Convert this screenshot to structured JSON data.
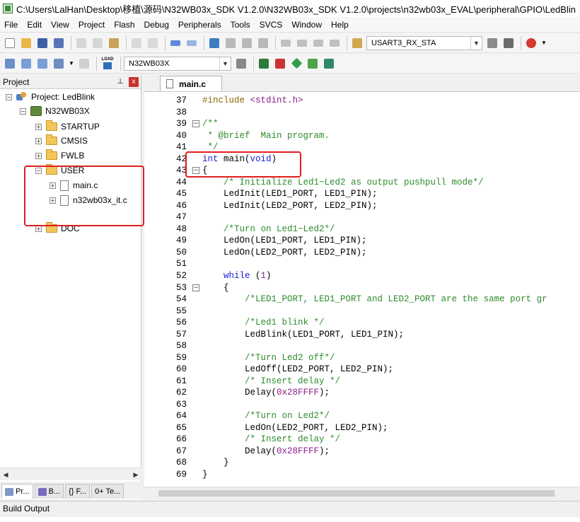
{
  "window": {
    "title": "C:\\Users\\LalHan\\Desktop\\移植\\源码\\N32WB03x_SDK V1.2.0\\N32WB03x_SDK V1.2.0\\projects\\n32wb03x_EVAL\\peripheral\\GPIO\\LedBlin"
  },
  "menu": [
    {
      "label": "File"
    },
    {
      "label": "Edit"
    },
    {
      "label": "View"
    },
    {
      "label": "Project"
    },
    {
      "label": "Flash"
    },
    {
      "label": "Debug"
    },
    {
      "label": "Peripherals"
    },
    {
      "label": "Tools"
    },
    {
      "label": "SVCS"
    },
    {
      "label": "Window"
    },
    {
      "label": "Help"
    }
  ],
  "toolbar1": {
    "find_combo_value": "USART3_RX_STA"
  },
  "toolbar2": {
    "load_label": "LOAD",
    "target_combo_value": "N32WB03X"
  },
  "project_pane": {
    "title": "Project",
    "pin_glyph": "⊥",
    "close_glyph": "x",
    "tree": [
      {
        "label": "Project: LedBlink"
      },
      {
        "label": "N32WB03X"
      },
      {
        "label": "STARTUP"
      },
      {
        "label": "CMSIS"
      },
      {
        "label": "FWLB"
      },
      {
        "label": "USER"
      },
      {
        "label": "main.c"
      },
      {
        "label": "n32wb03x_it.c"
      },
      {
        "label": "DOC"
      }
    ],
    "tabs": [
      {
        "label": "Pr..."
      },
      {
        "label": "B..."
      },
      {
        "label": "{} F..."
      },
      {
        "label": "0+ Te..."
      }
    ]
  },
  "editor": {
    "tab_label": "main.c",
    "lines": [
      {
        "n": "37",
        "fold": "",
        "seg": [
          {
            "c": "c-pre",
            "t": "#include "
          },
          {
            "c": "c-str",
            "t": "<stdint.h>"
          }
        ]
      },
      {
        "n": "38",
        "fold": "",
        "seg": []
      },
      {
        "n": "39",
        "fold": "−",
        "seg": [
          {
            "c": "c-com",
            "t": "/**"
          }
        ]
      },
      {
        "n": "40",
        "fold": "",
        "seg": [
          {
            "c": "c-com",
            "t": " * @brief  Main program."
          }
        ]
      },
      {
        "n": "41",
        "fold": "",
        "seg": [
          {
            "c": "c-com",
            "t": " */"
          }
        ]
      },
      {
        "n": "42",
        "fold": "",
        "seg": [
          {
            "c": "c-key",
            "t": "int"
          },
          {
            "c": "txt",
            "t": " main("
          },
          {
            "c": "c-key",
            "t": "void"
          },
          {
            "c": "txt",
            "t": ")"
          }
        ]
      },
      {
        "n": "43",
        "fold": "−",
        "seg": [
          {
            "c": "txt",
            "t": "{"
          }
        ]
      },
      {
        "n": "44",
        "fold": "",
        "seg": [
          {
            "c": "c-com",
            "t": "    /* Initialize Led1~Led2 as output pushpull mode*/"
          }
        ]
      },
      {
        "n": "45",
        "fold": "",
        "seg": [
          {
            "c": "txt",
            "t": "    LedInit(LED1_PORT, LED1_PIN);"
          }
        ]
      },
      {
        "n": "46",
        "fold": "",
        "seg": [
          {
            "c": "txt",
            "t": "    LedInit(LED2_PORT, LED2_PIN);"
          }
        ]
      },
      {
        "n": "47",
        "fold": "",
        "seg": []
      },
      {
        "n": "48",
        "fold": "",
        "seg": [
          {
            "c": "c-com",
            "t": "    /*Turn on Led1~Led2*/"
          }
        ]
      },
      {
        "n": "49",
        "fold": "",
        "seg": [
          {
            "c": "txt",
            "t": "    LedOn(LED1_PORT, LED1_PIN);"
          }
        ]
      },
      {
        "n": "50",
        "fold": "",
        "seg": [
          {
            "c": "txt",
            "t": "    LedOn(LED2_PORT, LED2_PIN);"
          }
        ]
      },
      {
        "n": "51",
        "fold": "",
        "seg": []
      },
      {
        "n": "52",
        "fold": "",
        "seg": [
          {
            "c": "c-key",
            "t": "    while"
          },
          {
            "c": "txt",
            "t": " ("
          },
          {
            "c": "c-num",
            "t": "1"
          },
          {
            "c": "txt",
            "t": ")"
          }
        ]
      },
      {
        "n": "53",
        "fold": "−",
        "seg": [
          {
            "c": "txt",
            "t": "    {"
          }
        ]
      },
      {
        "n": "54",
        "fold": "",
        "seg": [
          {
            "c": "c-com",
            "t": "        /*LED1_PORT, LED1_PORT and LED2_PORT are the same port gr"
          }
        ]
      },
      {
        "n": "55",
        "fold": "",
        "seg": []
      },
      {
        "n": "56",
        "fold": "",
        "seg": [
          {
            "c": "c-com",
            "t": "        /*Led1 blink */"
          }
        ]
      },
      {
        "n": "57",
        "fold": "",
        "seg": [
          {
            "c": "txt",
            "t": "        LedBlink(LED1_PORT, LED1_PIN);"
          }
        ]
      },
      {
        "n": "58",
        "fold": "",
        "seg": []
      },
      {
        "n": "59",
        "fold": "",
        "seg": [
          {
            "c": "c-com",
            "t": "        /*Turn Led2 off*/"
          }
        ]
      },
      {
        "n": "60",
        "fold": "",
        "seg": [
          {
            "c": "txt",
            "t": "        LedOff(LED2_PORT, LED2_PIN);"
          }
        ]
      },
      {
        "n": "61",
        "fold": "",
        "seg": [
          {
            "c": "c-com",
            "t": "        /* Insert delay */"
          }
        ]
      },
      {
        "n": "62",
        "fold": "",
        "seg": [
          {
            "c": "txt",
            "t": "        Delay("
          },
          {
            "c": "c-num",
            "t": "0x28FFFF"
          },
          {
            "c": "txt",
            "t": ");"
          }
        ]
      },
      {
        "n": "63",
        "fold": "",
        "seg": []
      },
      {
        "n": "64",
        "fold": "",
        "seg": [
          {
            "c": "c-com",
            "t": "        /*Turn on Led2*/"
          }
        ]
      },
      {
        "n": "65",
        "fold": "",
        "seg": [
          {
            "c": "txt",
            "t": "        LedOn(LED2_PORT, LED2_PIN);"
          }
        ]
      },
      {
        "n": "66",
        "fold": "",
        "seg": [
          {
            "c": "c-com",
            "t": "        /* Insert delay */"
          }
        ]
      },
      {
        "n": "67",
        "fold": "",
        "seg": [
          {
            "c": "txt",
            "t": "        Delay("
          },
          {
            "c": "c-num",
            "t": "0x28FFFF"
          },
          {
            "c": "txt",
            "t": ");"
          }
        ]
      },
      {
        "n": "68",
        "fold": "",
        "seg": [
          {
            "c": "txt",
            "t": "    }"
          }
        ]
      },
      {
        "n": "69",
        "fold": "",
        "seg": [
          {
            "c": "txt",
            "t": "}"
          }
        ]
      }
    ]
  },
  "build_output": {
    "title": "Build Output"
  },
  "colors": {
    "highlight_box": "#e11e1e",
    "comment": "#2e8b2e",
    "keyword": "#1c1cd6",
    "number": "#8a1c8a"
  }
}
